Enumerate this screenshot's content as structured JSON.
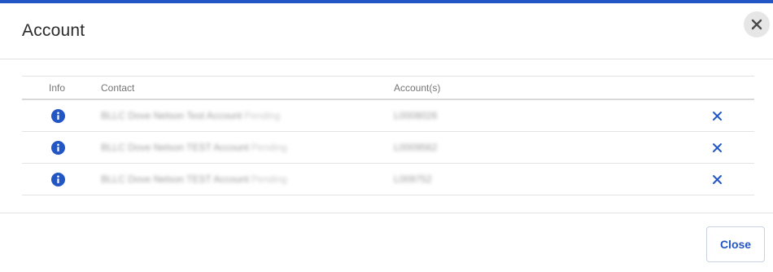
{
  "colors": {
    "accent": "#2356c5",
    "info_icon": "#2356c5",
    "close_bg": "#e6e6e6"
  },
  "modal": {
    "title": "Account",
    "close_icon": "close-icon"
  },
  "table": {
    "columns": {
      "info": "Info",
      "contact": "Contact",
      "accounts": "Account(s)"
    },
    "rows": [
      {
        "contact": "BLLC Dove Nelson Test Account",
        "status": "Pending",
        "account": "L0008026"
      },
      {
        "contact": "BLLC Dove Nelson TEST Account",
        "status": "Pending",
        "account": "L0009562"
      },
      {
        "contact": "BLLC Dove Nelson TEST Account",
        "status": "Pending",
        "account": "L009752"
      }
    ],
    "row_icons": {
      "info": "info-icon",
      "remove": "remove-icon"
    }
  },
  "footer": {
    "close_label": "Close"
  }
}
